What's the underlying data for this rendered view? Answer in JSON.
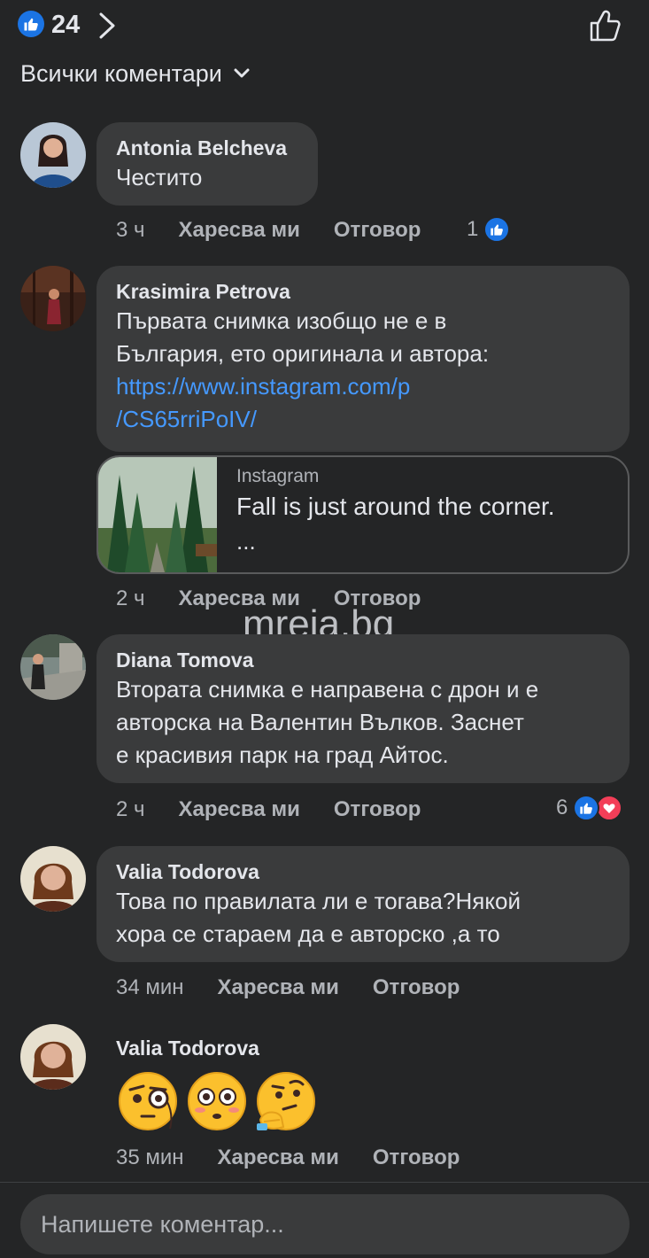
{
  "header": {
    "like_count": "24",
    "filter_label": "Всички коментари"
  },
  "actions": {
    "like_label": "Харесва ми",
    "reply_label": "Отговор"
  },
  "comments": [
    {
      "author": "Antonia Belcheva",
      "text": "Честито",
      "time": "3 ч",
      "reaction_count": "1",
      "reactions": [
        "like-icon"
      ]
    },
    {
      "author": "Krasimira Petrova",
      "text_lines": [
        "Първата снимка изобщо не е в",
        "България, ето оригинала и автора:"
      ],
      "link_lines": [
        "https://www.instagram.com/p",
        "/CS65rriPoIV/"
      ],
      "time": "2 ч",
      "link_preview": {
        "source": "Instagram",
        "title": "Fall is just around the corner.",
        "more": "..."
      }
    },
    {
      "author": "Diana Tomova",
      "text_lines": [
        "Втората снимка е направена с дрон и е",
        "авторска на Валентин Вълков.  Заснет",
        "е красивия парк на град Айтос."
      ],
      "time": "2 ч",
      "reaction_count": "6",
      "reactions": [
        "like-icon",
        "love-icon"
      ]
    },
    {
      "author": "Valia Todorova",
      "text_lines": [
        "Това по правилата ли е тогава?Някой",
        "хора се стараем да е авторско ,а то"
      ],
      "time": "34 мин"
    },
    {
      "author": "Valia Todorova",
      "emojis": [
        "face-with-monocle-emoji",
        "flushed-face-emoji",
        "thinking-face-emoji"
      ],
      "time": "35 мин"
    }
  ],
  "watermark": "mreja.bg",
  "composer": {
    "placeholder": "Напишете коментар..."
  },
  "colors": {
    "background": "#242526",
    "bubble": "#3a3b3c",
    "accent_blue": "#1b74e4",
    "link": "#4599ff",
    "love_red": "#f33e58",
    "muted_text": "#b0b3b8"
  }
}
